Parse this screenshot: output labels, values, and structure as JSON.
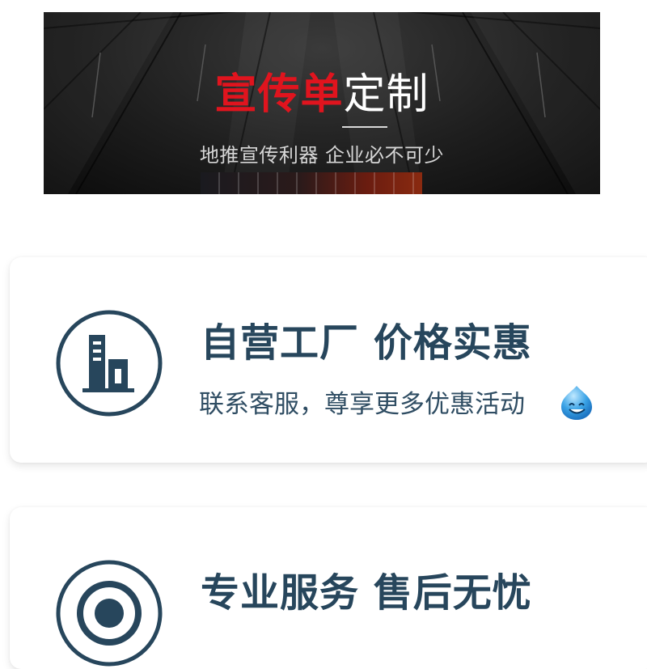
{
  "banner": {
    "title_highlight": "宣传单",
    "title_rest": "定制",
    "subtitle": "地推宣传利器  企业必不可少",
    "colors": {
      "highlight": "#e0141e",
      "text": "#ffffff",
      "background": "#1e1e1e"
    }
  },
  "features": [
    {
      "icon": "building-icon",
      "title": "自营工厂 价格实惠",
      "subtitle": "联系客服，尊享更多优惠活动",
      "emoji": "smiley-face-icon"
    },
    {
      "icon": "service-icon",
      "title": "专业服务 售后无忧"
    }
  ],
  "colors": {
    "accent": "#27465c"
  }
}
